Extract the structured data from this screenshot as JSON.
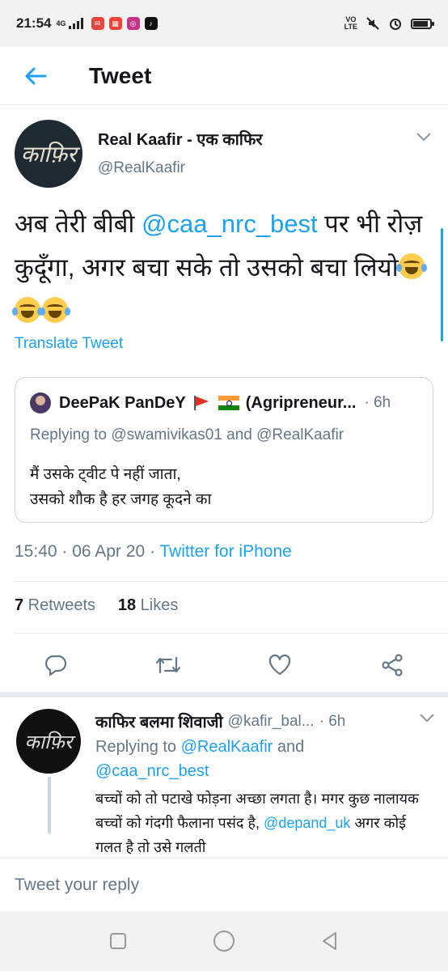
{
  "status_bar": {
    "time": "21:54",
    "network": "4G",
    "volte": "VO\nLTE",
    "battery_level": 0.9
  },
  "header": {
    "title": "Tweet"
  },
  "tweet": {
    "display_name": "Real Kaafir - एक काफिर",
    "handle": "@RealKaafir",
    "avatar_text": "काफ़िर",
    "text_before": "अब तेरी बीबी ",
    "mention": "@caa_nrc_best",
    "text_after": " पर भी रोज़ कुदूँगा, अगर बचा सके तो उसको बचा लियो",
    "translate_label": "Translate Tweet",
    "timestamp": "15:40 · 06 Apr 20 · ",
    "source": "Twitter for iPhone",
    "retweets_count": "7",
    "retweets_label": " Retweets",
    "likes_count": "18",
    "likes_label": " Likes"
  },
  "quote": {
    "name": "DeePaK PanDeY",
    "affiliation": "(Agripreneur...",
    "time": "· 6h",
    "replying_to": "Replying to @swamivikas01 and @RealKaafir",
    "line1": "मैं उसके ट्वीट पे नहीं जाता,",
    "line2": "उसको शौक है हर जगह कूदने का"
  },
  "reply": {
    "name": "काफिर बलमा शिवाजी",
    "handle": "@kafir_bal...",
    "time": "· 6h",
    "avatar_text": "काफ़िर",
    "replying_prefix": "Replying to ",
    "replying_mention1": "@RealKaafir",
    "replying_and": " and",
    "replying_mention2": "@caa_nrc_best",
    "body_text": "बच्चों को तो पटाखे फोड़ना अच्छा लगता है। मगर कुछ नालायक बच्चों को गंदगी फैलाना पसंद है, ",
    "body_mention": "@depand_uk",
    "body_after": " अगर कोई गलत है तो उसे गलती"
  },
  "composer": {
    "placeholder": "Tweet your reply"
  },
  "colors": {
    "accent": "#1da1f2",
    "secondary_text": "#657786",
    "border": "#e6ecf0"
  },
  "icons": [
    "back-arrow-icon",
    "chevron-down-icon",
    "reply-icon",
    "retweet-icon",
    "like-icon",
    "share-icon",
    "square-nav-icon",
    "circle-nav-icon",
    "triangle-nav-icon"
  ]
}
